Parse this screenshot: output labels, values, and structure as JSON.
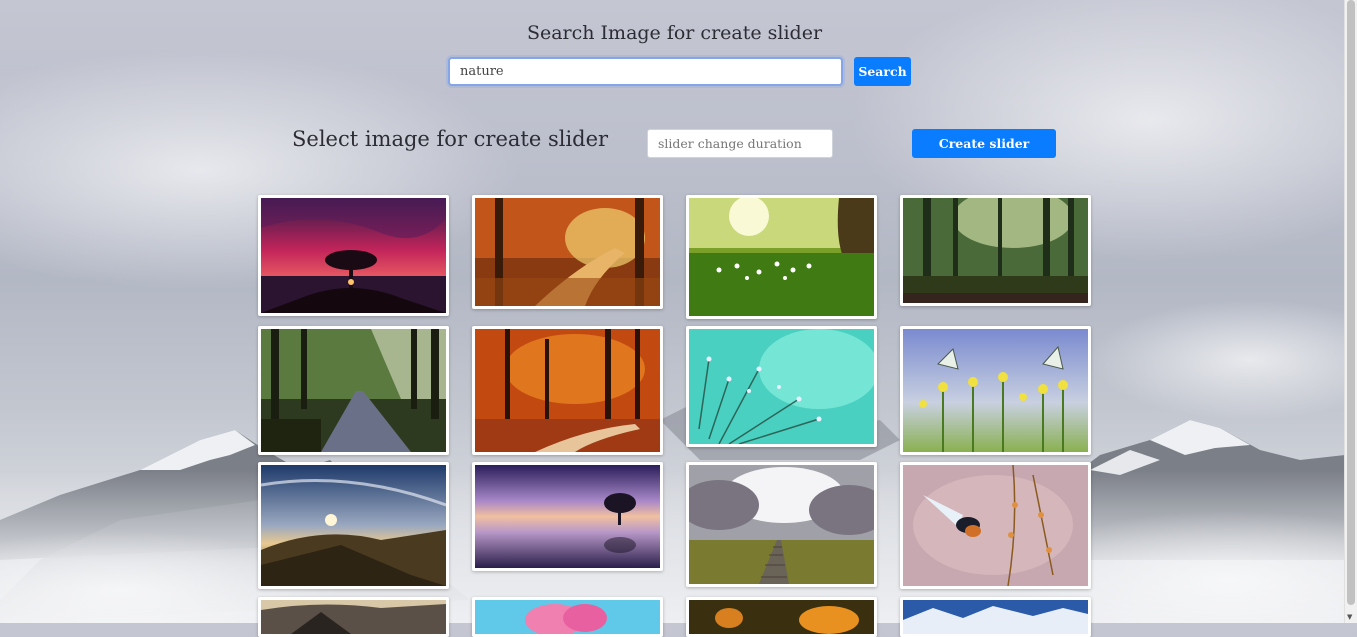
{
  "search": {
    "title": "Search Image for create slider",
    "query": "nature",
    "button_label": "Search"
  },
  "slider": {
    "title": "Select image for create slider",
    "duration_placeholder": "slider change duration",
    "create_button_label": "Create slider"
  },
  "gallery": {
    "images": [
      {
        "subject": "tree-silhouette-sunset"
      },
      {
        "subject": "autumn-forest-path"
      },
      {
        "subject": "sunny-meadow-flowers"
      },
      {
        "subject": "misty-green-forest"
      },
      {
        "subject": "forest-road-sunbeams"
      },
      {
        "subject": "red-autumn-forest"
      },
      {
        "subject": "dandelion-dew-drops"
      },
      {
        "subject": "butterflies-flowers"
      },
      {
        "subject": "mountain-sunset-clouds"
      },
      {
        "subject": "lone-tree-lake-dusk"
      },
      {
        "subject": "railway-cloudy-sky"
      },
      {
        "subject": "bird-flight-branch"
      },
      {
        "subject": "cloudy-mountain-peak"
      },
      {
        "subject": "pink-flower-petals"
      },
      {
        "subject": "butterfly-orange-flowers"
      },
      {
        "subject": "snowy-mountain-range"
      }
    ]
  }
}
